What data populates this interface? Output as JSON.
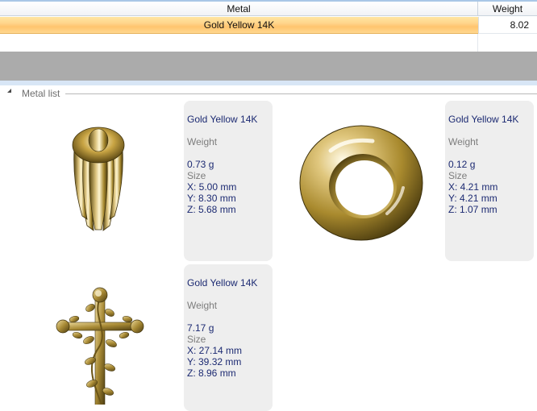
{
  "grid": {
    "columns": {
      "metal": "Metal",
      "weight": "Weight"
    },
    "rows": [
      {
        "metal": "Gold Yellow 14K",
        "weight": "8.02"
      }
    ]
  },
  "metal_list": {
    "label": "Metal list",
    "items": [
      {
        "title": "Gold Yellow 14K",
        "weight_label": "Weight",
        "weight": "0.73 g",
        "size_label": "Size",
        "x": "X: 5.00 mm",
        "y": "Y: 8.30 mm",
        "z": "Z: 5.68 mm",
        "icon": "gold-bail-pendant-icon"
      },
      {
        "title": "Gold Yellow 14K",
        "weight_label": "Weight",
        "weight": "0.12 g",
        "size_label": "Size",
        "x": "X: 4.21 mm",
        "y": "Y: 4.21 mm",
        "z": "Z: 1.07 mm",
        "icon": "gold-ring-icon"
      },
      {
        "title": "Gold Yellow 14K",
        "weight_label": "Weight",
        "weight": "7.17 g",
        "size_label": "Size",
        "x": "X: 27.14 mm",
        "y": "Y: 39.32 mm",
        "z": "Z: 8.96 mm",
        "icon": "gold-rose-cross-icon"
      }
    ]
  },
  "colors": {
    "selection": "#ffd48a",
    "header_line": "#a9c7e6",
    "band": "#ababab",
    "card": "#eeeeee",
    "value_text": "#1c2a72",
    "gold": "#c9a544"
  }
}
